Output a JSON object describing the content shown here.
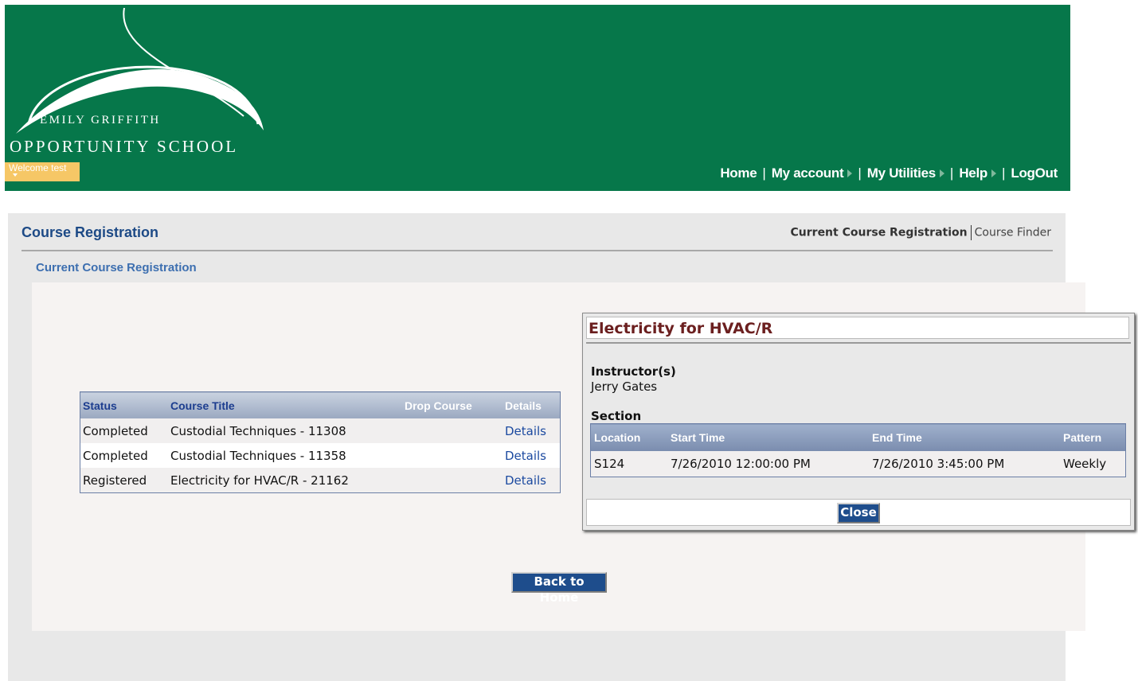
{
  "logo": {
    "line1": "EMILY GRIFFITH",
    "line2": "OPPORTUNITY SCHOOL"
  },
  "welcome": "Welcome test",
  "topnav": {
    "home": "Home",
    "my_account": "My account",
    "my_utilities": "My Utilities",
    "help": "Help",
    "logout": "LogOut",
    "separator": "|"
  },
  "page": {
    "title": "Course Registration",
    "subnav_active": "Current Course Registration",
    "subnav_link": "Course Finder",
    "section_title": "Current Course Registration"
  },
  "course_table": {
    "headers": {
      "status": "Status",
      "course_title": "Course Title",
      "drop_course": "Drop Course",
      "details": "Details"
    },
    "rows": [
      {
        "status": "Completed",
        "title": "Custodial Techniques - 11308",
        "drop": "",
        "details": "Details"
      },
      {
        "status": "Completed",
        "title": "Custodial Techniques - 11358",
        "drop": "",
        "details": "Details"
      },
      {
        "status": "Registered",
        "title": "Electricity for HVAC/R - 21162",
        "drop": "",
        "details": "Details"
      }
    ]
  },
  "back_button": "Back to Home",
  "modal": {
    "title": "Electricity for HVAC/R",
    "instructor_label": "Instructor(s)",
    "instructor": "Jerry Gates",
    "section_label": "Section",
    "section_headers": {
      "location": "Location",
      "start_time": "Start Time",
      "end_time": "End Time",
      "pattern": "Pattern"
    },
    "section_row": {
      "location": "S124",
      "start_time": "7/26/2010 12:00:00 PM",
      "end_time": "7/26/2010 3:45:00 PM",
      "pattern": "Weekly"
    },
    "close_button": "Close"
  },
  "colors": {
    "header_green": "#06774a",
    "link_blue": "#1c4aa0",
    "title_blue": "#1d4a86",
    "modal_title": "#6b1f1f",
    "button_blue": "#1e4d8c"
  }
}
